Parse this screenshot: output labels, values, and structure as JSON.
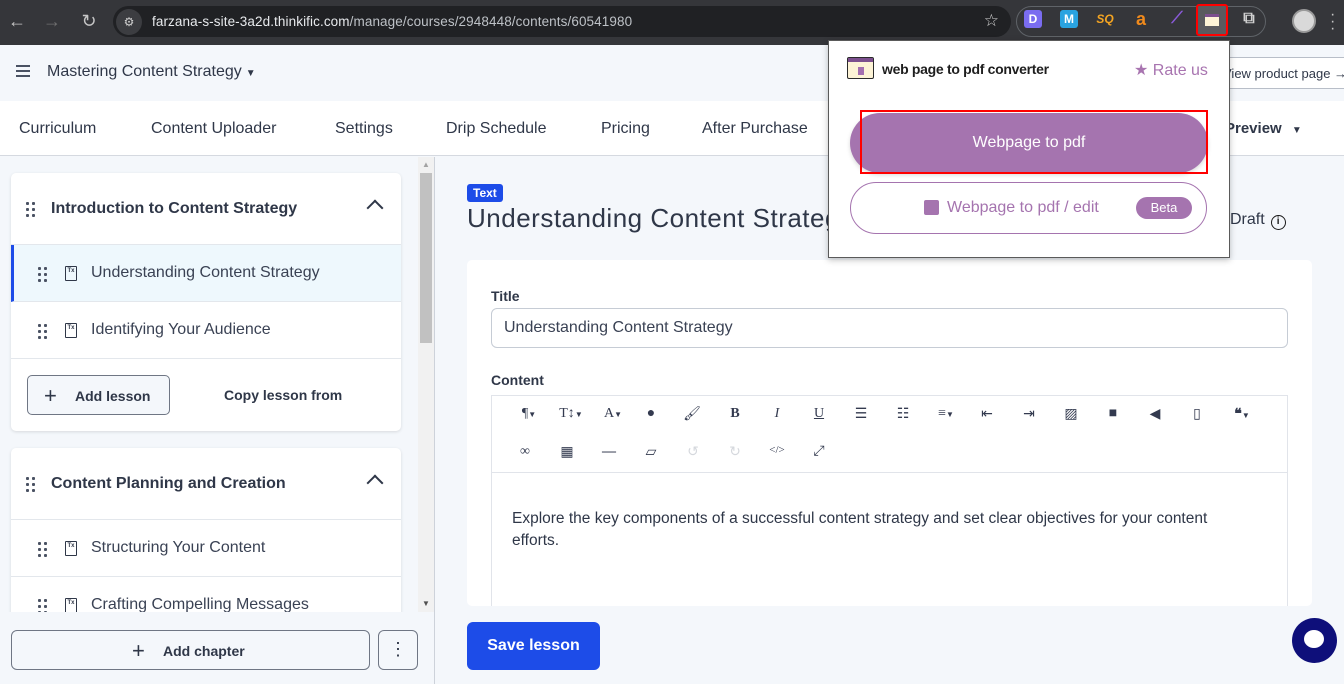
{
  "browser": {
    "url_host": "farzana-s-site-3a2d.thinkific.com",
    "url_path": "/manage/courses/2948448/contents/60541980",
    "extensions": [
      {
        "name": "D",
        "color": "#7a6cf0"
      },
      {
        "name": "M",
        "color": "#2aa3e0"
      },
      {
        "name": "SQ",
        "color": "#f3a422"
      },
      {
        "name": "a",
        "color": "#f08a1c"
      },
      {
        "name": "feather",
        "color": "#8a5ad8"
      }
    ]
  },
  "header": {
    "course_title": "Mastering Content Strategy",
    "product_page_label": "View product page →"
  },
  "tabs": [
    {
      "label": "Curriculum"
    },
    {
      "label": "Content Uploader"
    },
    {
      "label": "Settings"
    },
    {
      "label": "Drip Schedule"
    },
    {
      "label": "Pricing"
    },
    {
      "label": "After Purchase"
    }
  ],
  "preview_label": "Preview",
  "sidebar": {
    "chapters": [
      {
        "title": "Introduction to Content Strategy",
        "lessons": [
          {
            "label": "Understanding Content Strategy",
            "active": true
          },
          {
            "label": "Identifying Your Audience",
            "active": false
          }
        ]
      },
      {
        "title": "Content Planning and Creation",
        "lessons": [
          {
            "label": "Structuring Your Content",
            "active": false
          },
          {
            "label": "Crafting Compelling Messages",
            "active": false
          }
        ]
      }
    ],
    "add_lesson_label": "Add lesson",
    "copy_lesson_label": "Copy lesson from",
    "add_chapter_label": "Add chapter",
    "more_label": "⋮"
  },
  "main": {
    "type_badge": "Text",
    "heading": "Understanding Content Strategy",
    "status": "Draft",
    "title_label": "Title",
    "title_value": "Understanding Content Strategy",
    "content_label": "Content",
    "content_text": "Explore the key components of a successful content strategy and set clear objectives for your content efforts.",
    "save_label": "Save lesson"
  },
  "popup": {
    "title": "web page to pdf converter",
    "rate_label": "★ Rate us",
    "primary_label": "Webpage to pdf",
    "secondary_label": "Webpage to pdf / edit",
    "beta_label": "Beta",
    "accent": "#a574af"
  }
}
